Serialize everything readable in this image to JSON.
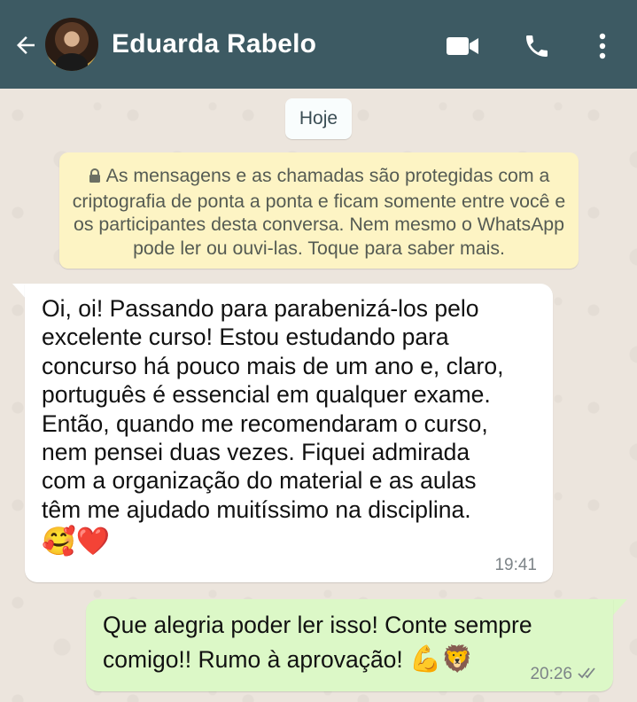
{
  "header": {
    "contact_name": "Eduarda Rabelo",
    "icons": [
      "back-arrow-icon",
      "video-call-icon",
      "phone-call-icon",
      "more-options-icon"
    ],
    "background_color": "#3d5a63"
  },
  "chat": {
    "date_label": "Hoje",
    "encryption_notice": "As mensagens e as chamadas são protegidas com a criptografia de ponta a ponta e ficam somente entre você e os participantes desta conversa. Nem mesmo o WhatsApp pode ler ou ouvi-las. Toque para saber mais.",
    "messages": [
      {
        "direction": "incoming",
        "text": "Oi, oi! Passando para parabenizá-los pelo\nexcelente curso! Estou estudando para\nconcurso há pouco mais de um ano e, claro,\nportuguês é essencial em qualquer exame.\nEntão, quando me recomendaram o curso,\nnem pensei duas vezes. Fiquei admirada\ncom a organização do material e as aulas\ntêm me ajudado muitíssimo na disciplina.",
        "emojis": "🥰❤️",
        "time": "19:41"
      },
      {
        "direction": "outgoing",
        "text": "Que alegria poder ler isso! Conte sempre comigo!! Rumo à aprovação!",
        "emojis": "💪🦁",
        "time": "20:26",
        "status": "read"
      }
    ]
  },
  "colors": {
    "incoming_bubble": "#ffffff",
    "outgoing_bubble": "#dcf8c7",
    "notice_bubble": "#fdf4c4",
    "read_ticks": "#7d8488"
  }
}
